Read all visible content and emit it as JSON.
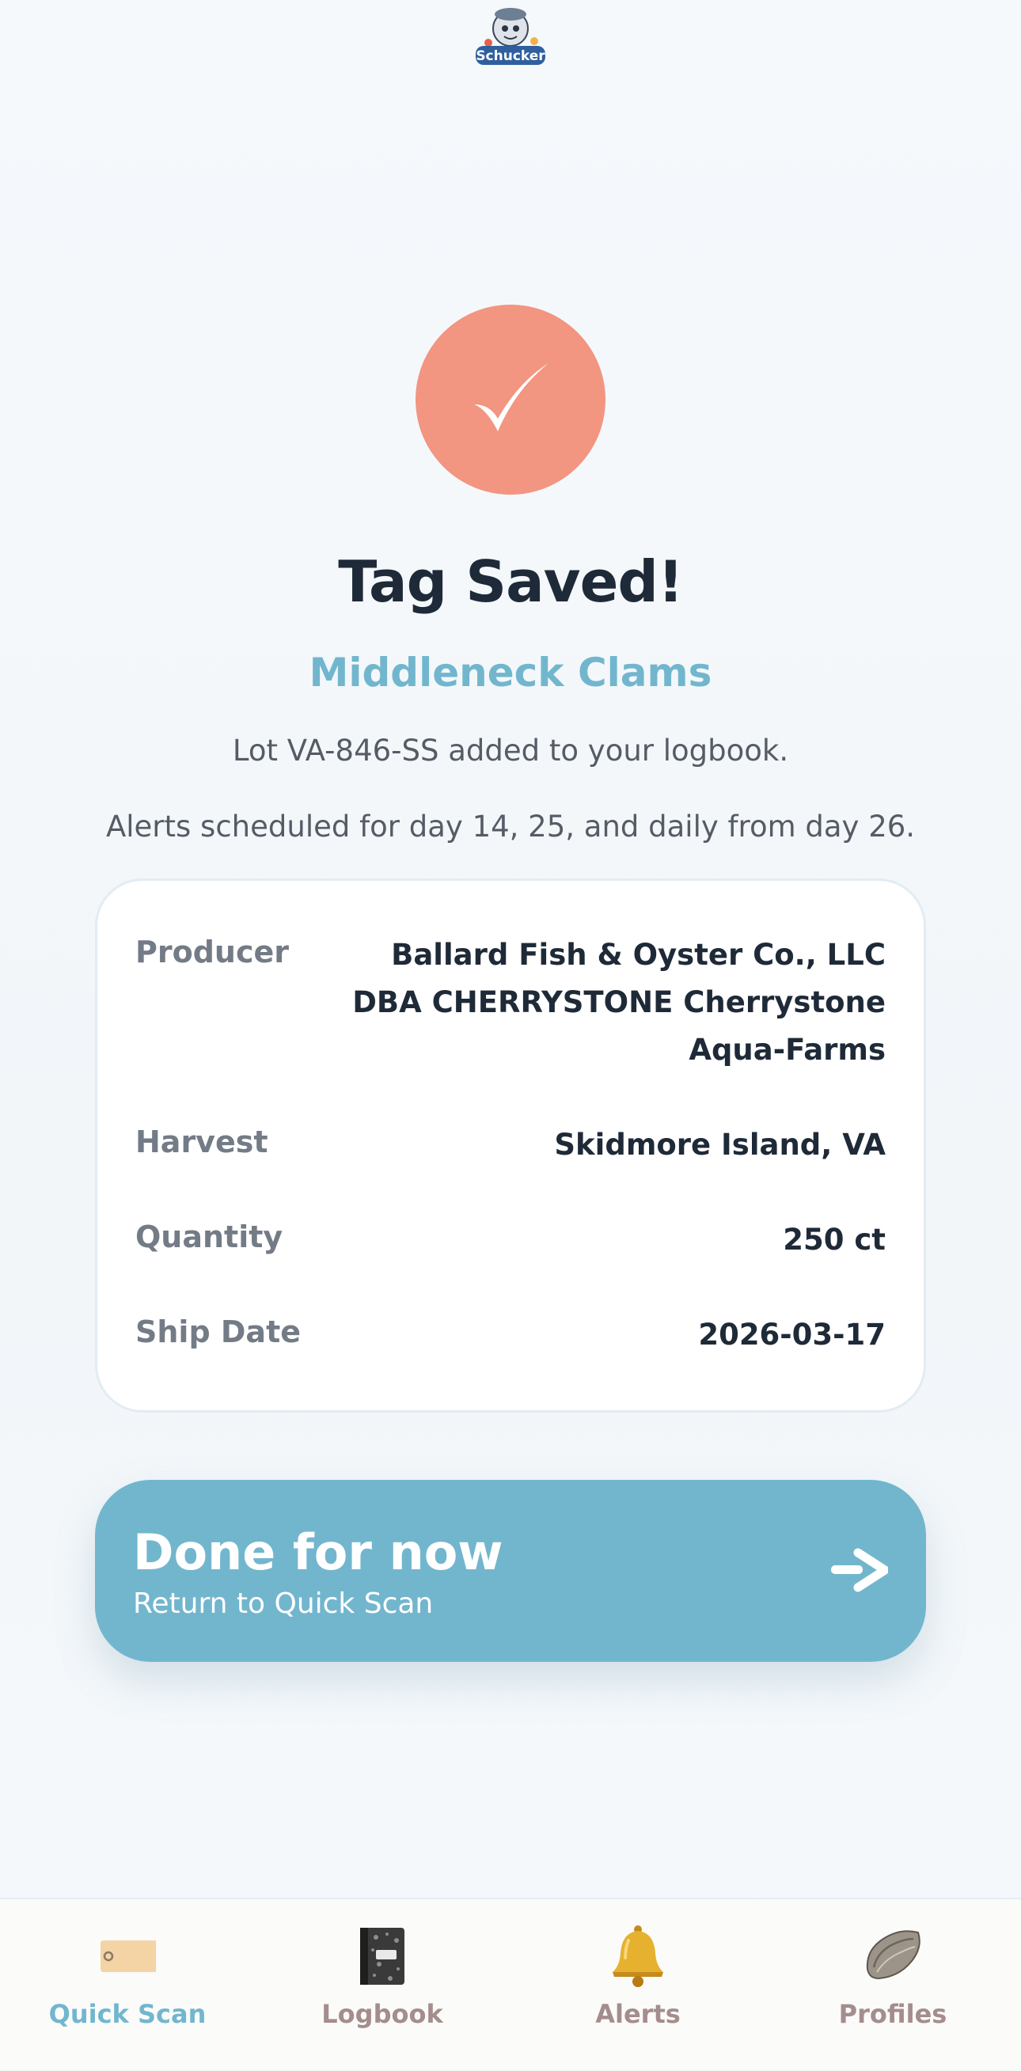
{
  "app": {
    "logo_text": "Schucker"
  },
  "success": {
    "icon": "checkmark-icon",
    "title": "Tag Saved!",
    "product": "Middleneck Clams",
    "lot_message": "Lot VA-846-SS added to your logbook.",
    "alerts_message": "Alerts scheduled for day 14, 25, and daily from day 26."
  },
  "details": [
    {
      "label": "Producer",
      "value": "Ballard Fish & Oyster Co., LLC DBA CHERRYSTONE Cherrystone Aqua-Farms"
    },
    {
      "label": "Harvest",
      "value": "Skidmore Island, VA"
    },
    {
      "label": "Quantity",
      "value": "250 ct"
    },
    {
      "label": "Ship Date",
      "value": "2026-03-17"
    }
  ],
  "done_button": {
    "title": "Done for now",
    "subtitle": "Return to Quick Scan",
    "arrow": "->"
  },
  "colors": {
    "accent": "#72b6ce",
    "success": "#f29581",
    "text_dark": "#1f2a38",
    "nav_inactive": "#a48d8c"
  },
  "nav": {
    "items": [
      {
        "label": "Quick Scan",
        "icon": "tag-icon",
        "active": true
      },
      {
        "label": "Logbook",
        "icon": "notebook-icon",
        "active": false
      },
      {
        "label": "Alerts",
        "icon": "bell-icon",
        "active": false
      },
      {
        "label": "Profiles",
        "icon": "oyster-icon",
        "active": false
      }
    ]
  }
}
